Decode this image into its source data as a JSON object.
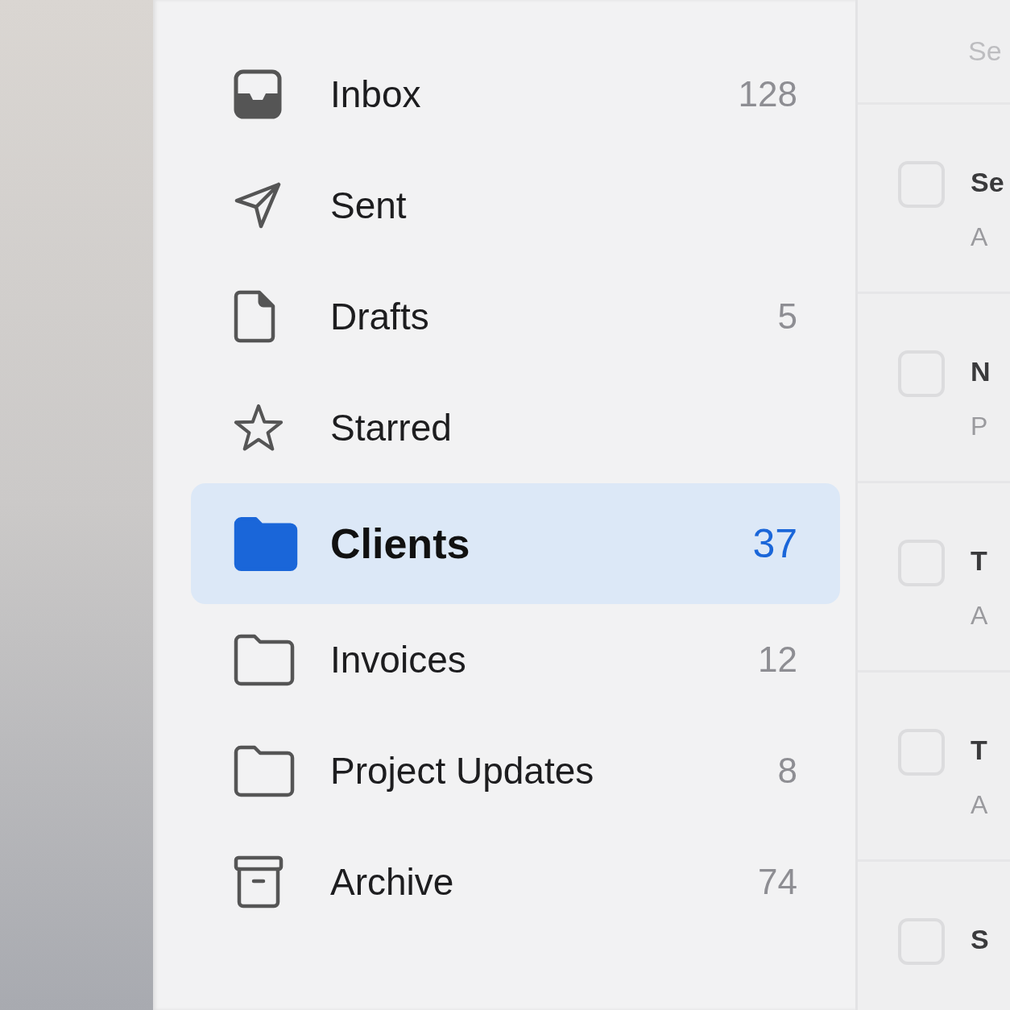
{
  "sidebar": {
    "folders": [
      {
        "label": "Inbox",
        "count": "128",
        "selected": false
      },
      {
        "label": "Sent",
        "selected": false
      },
      {
        "label": "Drafts",
        "count": "5",
        "selected": false
      },
      {
        "label": "Starred",
        "selected": false
      },
      {
        "label": "Clients",
        "count": "37",
        "selected": true
      },
      {
        "label": "Invoices",
        "count": "12",
        "selected": false
      },
      {
        "label": "Project Updates",
        "count": "8",
        "selected": false
      },
      {
        "label": "Archive",
        "count": "74",
        "selected": false
      }
    ]
  },
  "message_list": {
    "header": "Se",
    "rows": [
      {
        "checked": false,
        "first_line": "Se",
        "second_line": "A"
      },
      {
        "checked": false,
        "first_line": "N",
        "second_line": "P"
      },
      {
        "checked": false,
        "first_line": "T",
        "second_line": "A"
      },
      {
        "checked": false,
        "first_line": "T",
        "second_line": "A"
      },
      {
        "checked": false,
        "first_line": "S"
      }
    ]
  }
}
